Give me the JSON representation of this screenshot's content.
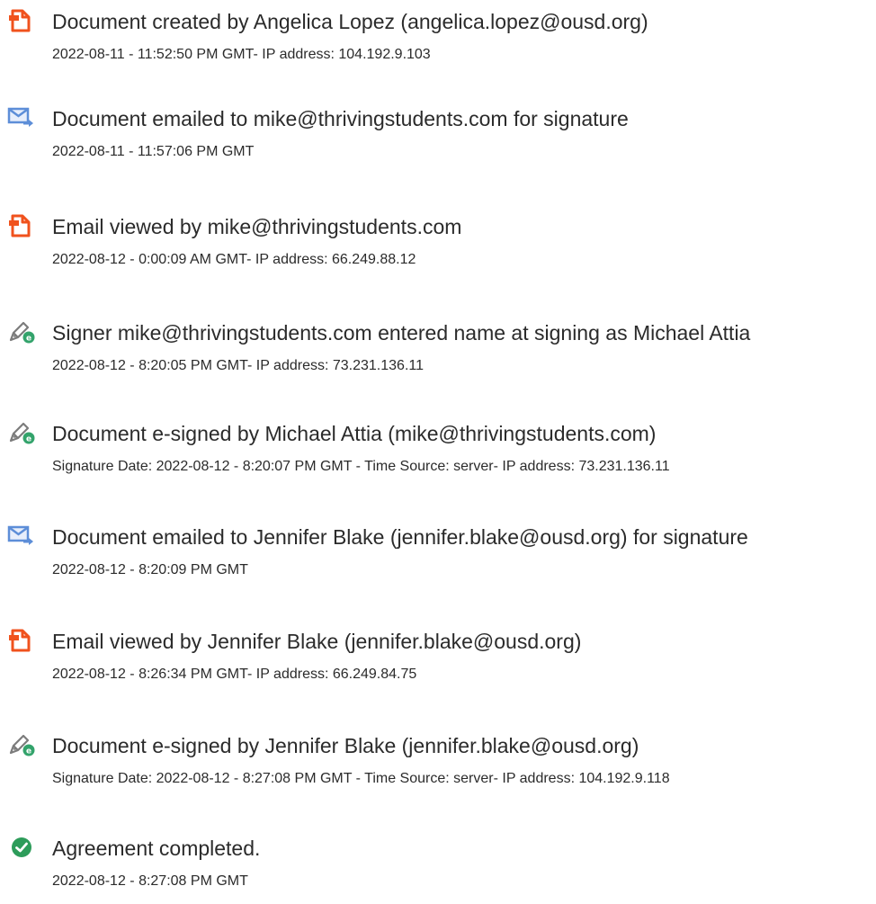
{
  "events": [
    {
      "icon": "document-created-icon",
      "title": "Document created by Angelica Lopez (angelica.lopez@ousd.org)",
      "meta": "2022-08-11 - 11:52:50 PM GMT- IP address: 104.192.9.103"
    },
    {
      "icon": "email-sent-icon",
      "title": "Document emailed to mike@thrivingstudents.com for signature",
      "meta": "2022-08-11 - 11:57:06 PM GMT"
    },
    {
      "icon": "document-viewed-icon",
      "title": "Email viewed by mike@thrivingstudents.com",
      "meta": "2022-08-12 - 0:00:09 AM GMT- IP address: 66.249.88.12"
    },
    {
      "icon": "signer-pen-icon",
      "title": "Signer mike@thrivingstudents.com entered name at signing as Michael Attia",
      "meta": "2022-08-12 - 8:20:05 PM GMT- IP address: 73.231.136.11"
    },
    {
      "icon": "e-signed-pen-icon",
      "title": "Document e-signed by Michael Attia (mike@thrivingstudents.com)",
      "meta": "Signature Date: 2022-08-12 - 8:20:07 PM GMT - Time Source: server- IP address: 73.231.136.11"
    },
    {
      "icon": "email-sent-icon",
      "title": "Document emailed to Jennifer Blake (jennifer.blake@ousd.org) for signature",
      "meta": "2022-08-12 - 8:20:09 PM GMT"
    },
    {
      "icon": "document-viewed-icon",
      "title": "Email viewed by Jennifer Blake (jennifer.blake@ousd.org)",
      "meta": "2022-08-12 - 8:26:34 PM GMT- IP address: 66.249.84.75"
    },
    {
      "icon": "e-signed-pen-icon",
      "title": "Document e-signed by Jennifer Blake (jennifer.blake@ousd.org)",
      "meta": "Signature Date: 2022-08-12 - 8:27:08 PM GMT - Time Source: server- IP address: 104.192.9.118"
    },
    {
      "icon": "completed-check-icon",
      "title": "Agreement completed.",
      "meta": "2022-08-12 - 8:27:08 PM GMT"
    }
  ],
  "colors": {
    "document_icon": "#f0521d",
    "email_icon": "#5d8ed8",
    "pen_icon": "#7c7c7c",
    "pen_badge": "#33a36b",
    "check_icon": "#2d9c5a",
    "text": "#2b2b2b"
  }
}
